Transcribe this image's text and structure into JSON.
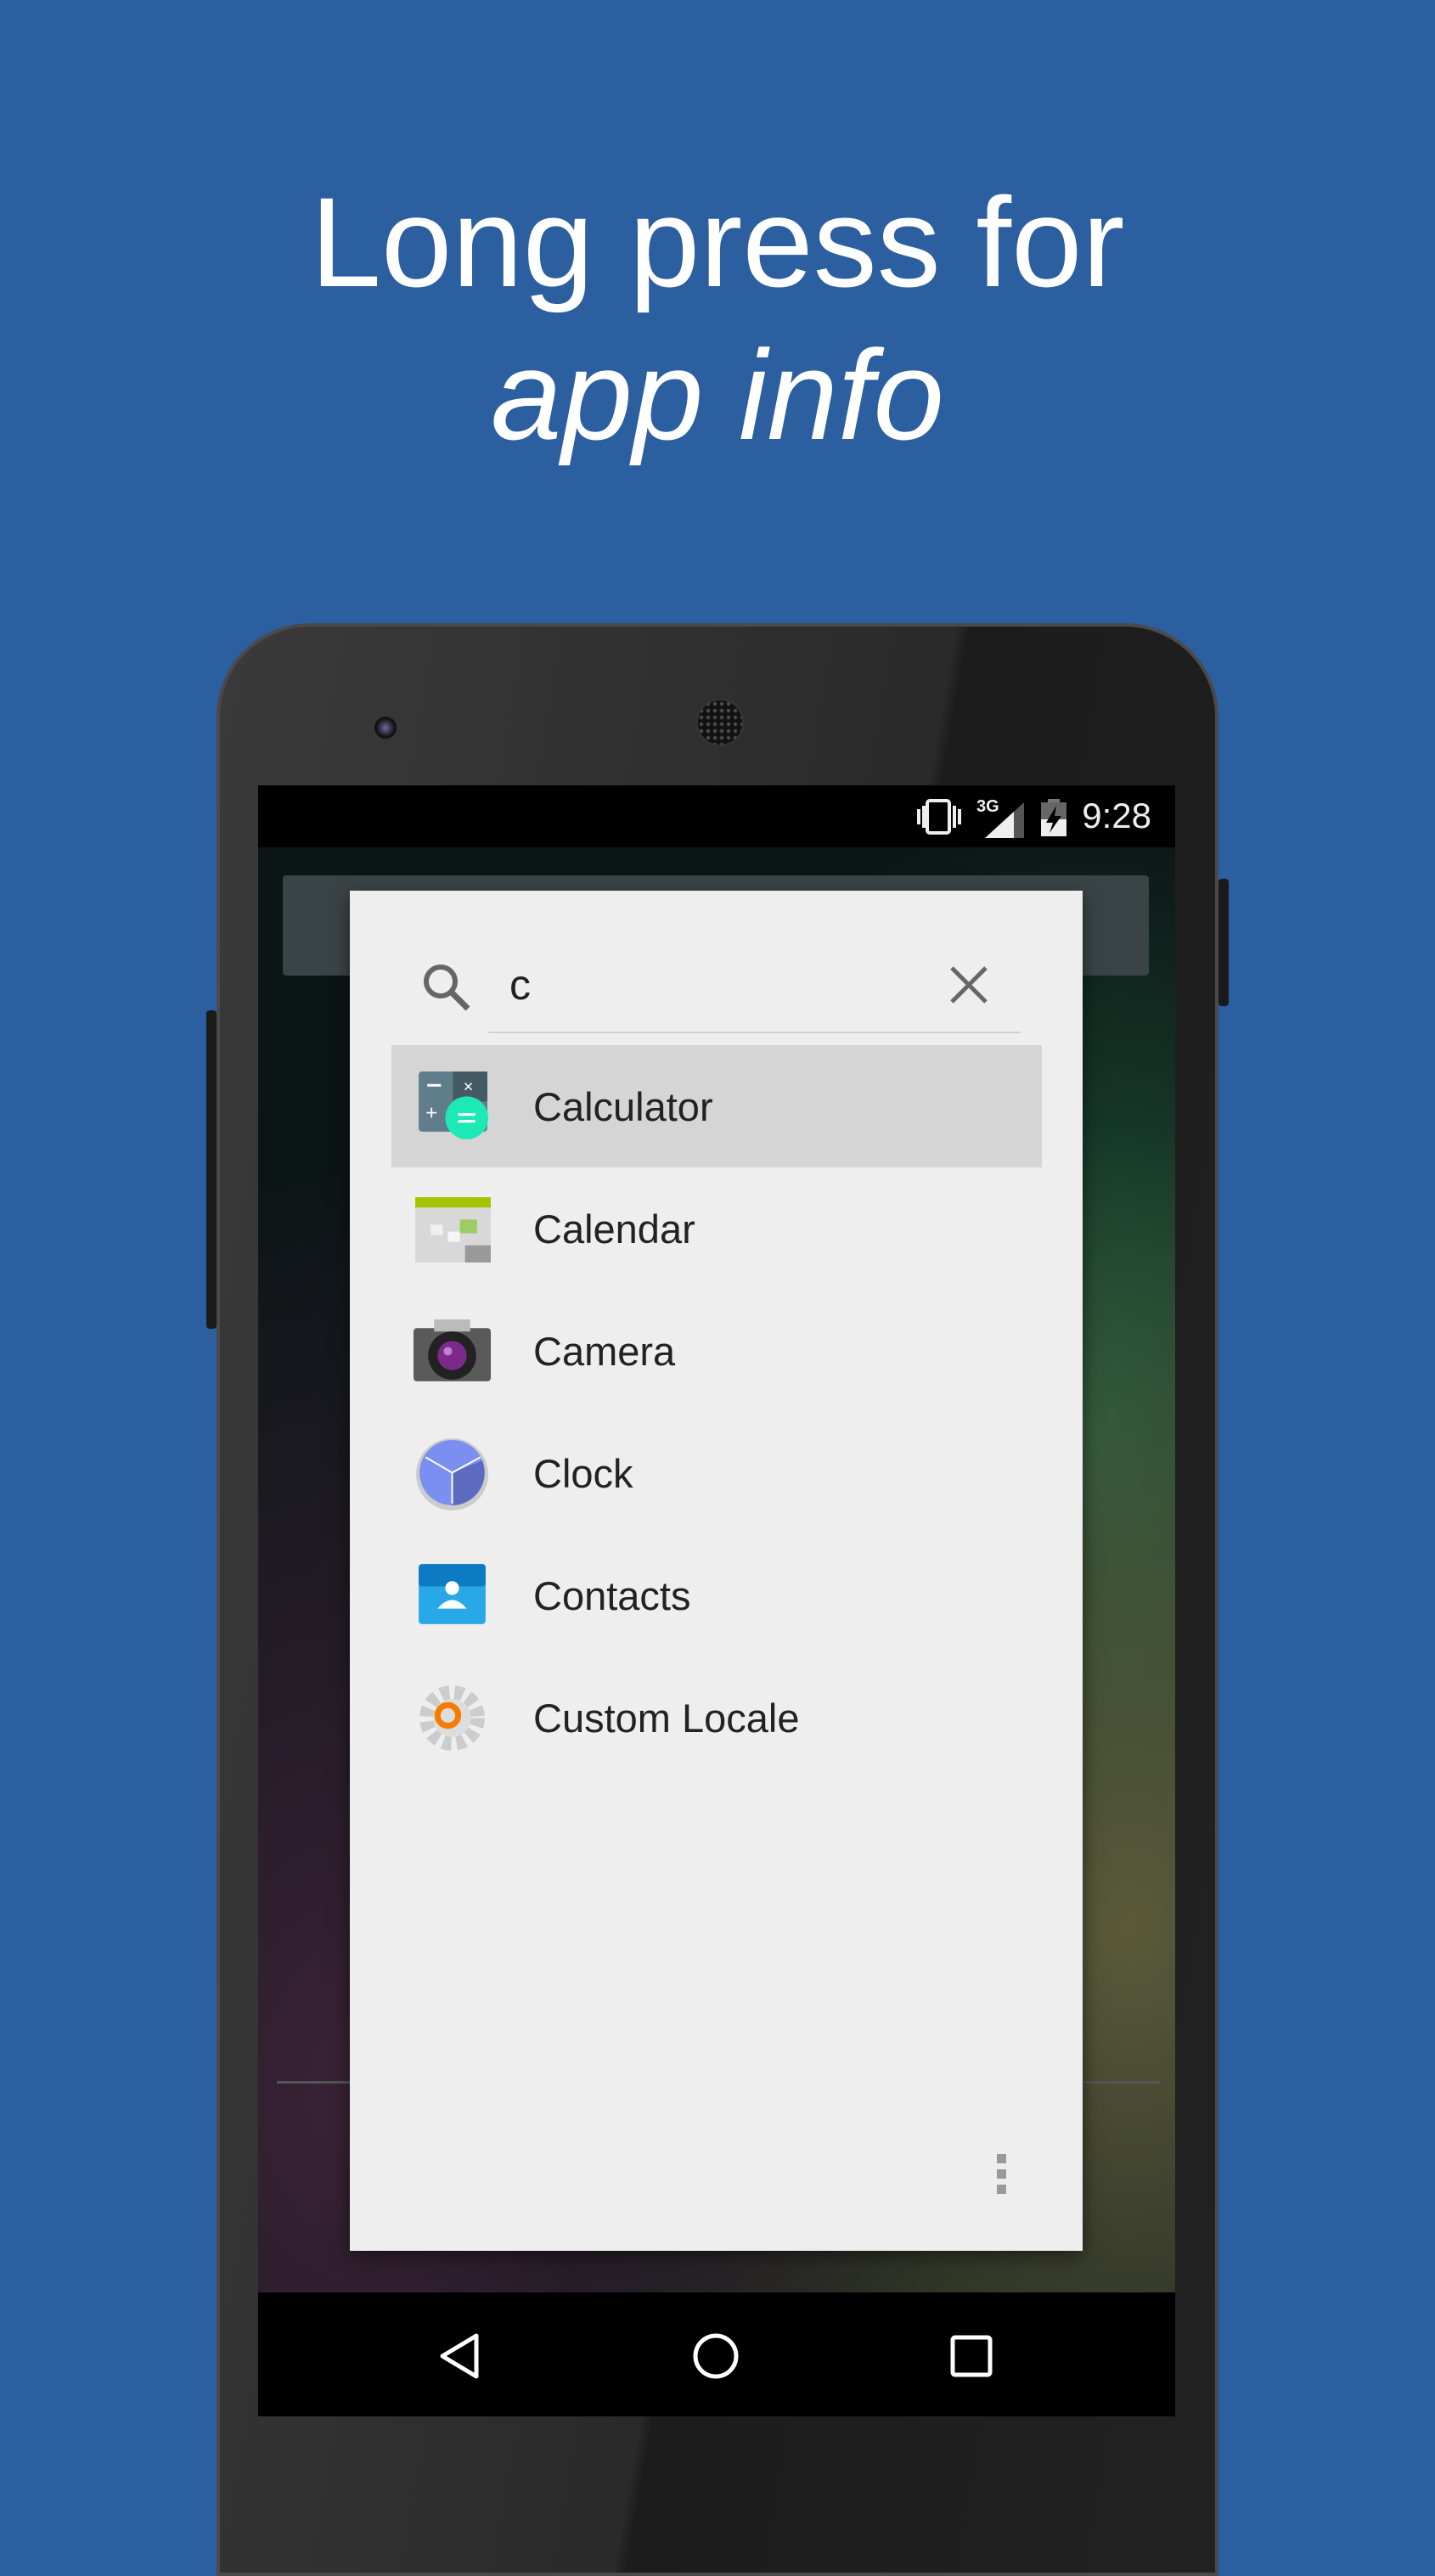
{
  "headline": {
    "line1": "Long press for",
    "line2": "app info"
  },
  "status_bar": {
    "time": "9:28",
    "network": "3G",
    "icons": [
      "vibrate-icon",
      "signal-icon",
      "battery-charging-icon"
    ]
  },
  "search": {
    "value": "c",
    "placeholder": ""
  },
  "apps": [
    {
      "label": "Calculator",
      "icon": "calculator-icon",
      "selected": true
    },
    {
      "label": "Calendar",
      "icon": "calendar-icon"
    },
    {
      "label": "Camera",
      "icon": "camera-icon"
    },
    {
      "label": "Clock",
      "icon": "clock-icon"
    },
    {
      "label": "Contacts",
      "icon": "contacts-icon"
    },
    {
      "label": "Custom Locale",
      "icon": "gear-icon"
    }
  ],
  "colors": {
    "background": "#2c5fa0",
    "dialog": "#eeeeee",
    "selected_row": "#d5d5d5"
  }
}
